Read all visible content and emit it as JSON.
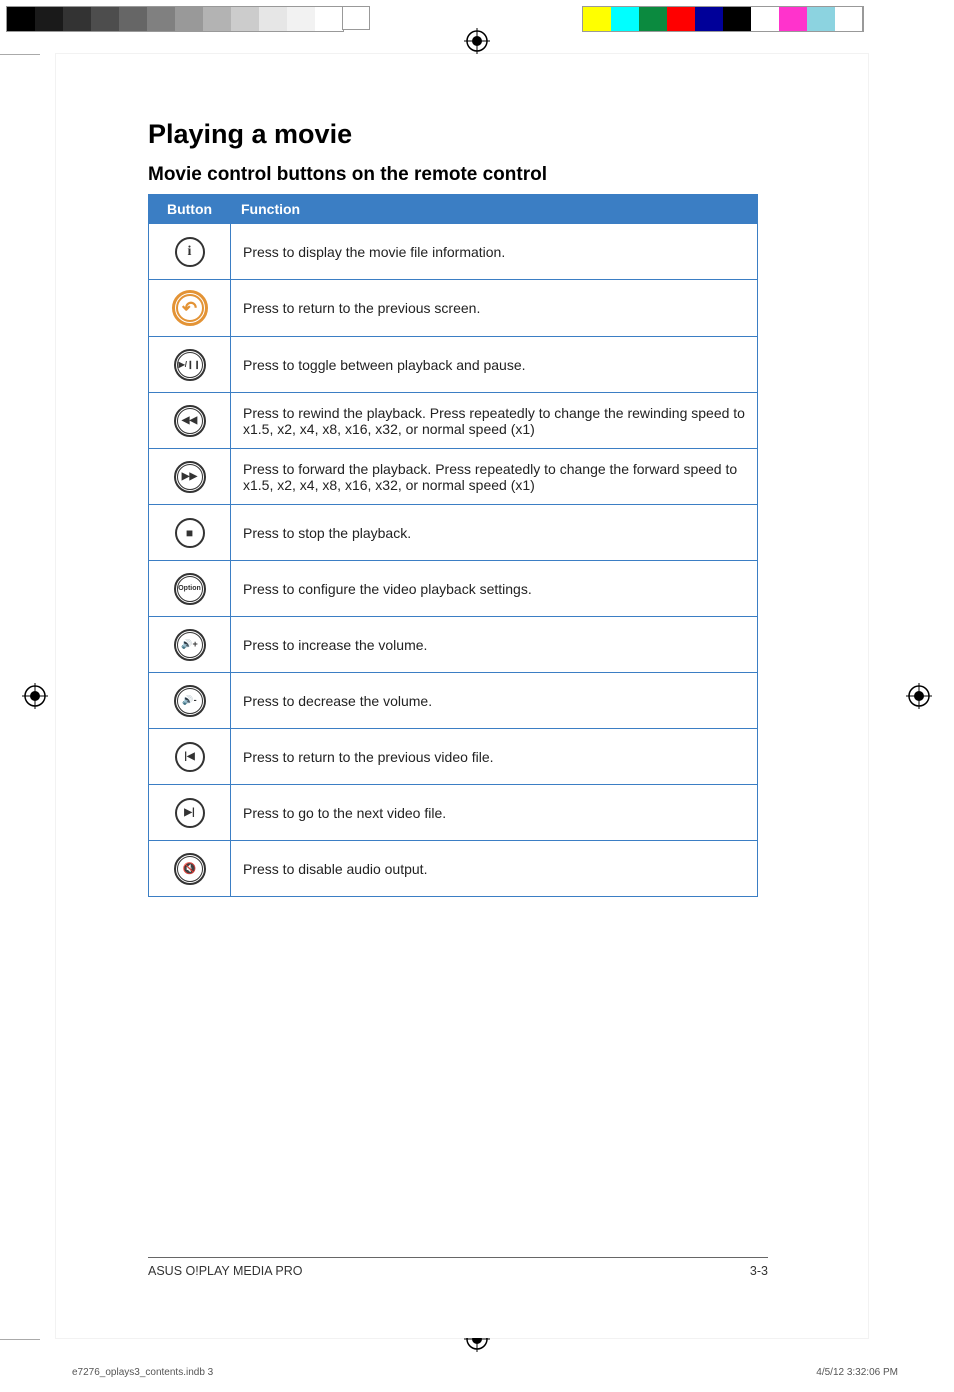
{
  "headings": {
    "h1": "Playing a movie",
    "h2": "Movie control buttons on the remote control"
  },
  "table": {
    "headers": {
      "button": "Button",
      "function": "Function"
    },
    "rows": [
      {
        "icon": "info",
        "glyph": "i",
        "desc": "Press to display the movie file information."
      },
      {
        "icon": "back",
        "glyph": "↶",
        "desc": "Press to return to the previous screen."
      },
      {
        "icon": "play-pause",
        "glyph": "▶/❙❙",
        "desc": "Press to toggle between playback and pause."
      },
      {
        "icon": "rewind",
        "glyph": "◀◀",
        "desc": "Press to rewind the playback. Press repeatedly to change the rewinding speed to x1.5, x2, x4, x8, x16, x32, or normal speed (x1)"
      },
      {
        "icon": "forward",
        "glyph": "▶▶",
        "desc": "Press to forward the playback. Press repeatedly to change the forward speed to x1.5, x2, x4, x8, x16, x32, or normal speed (x1)"
      },
      {
        "icon": "stop",
        "glyph": "■",
        "desc": "Press to stop the playback."
      },
      {
        "icon": "option",
        "glyph": "Option",
        "desc": "Press to configure the video playback settings."
      },
      {
        "icon": "vol-up",
        "glyph": "🔊+",
        "desc": "Press to increase the volume."
      },
      {
        "icon": "vol-down",
        "glyph": "🔊-",
        "desc": "Press to decrease the volume."
      },
      {
        "icon": "prev-track",
        "glyph": "|◀",
        "desc": "Press to return to the previous video file."
      },
      {
        "icon": "next-track",
        "glyph": "▶|",
        "desc": "Press to go to the next video file."
      },
      {
        "icon": "mute",
        "glyph": "🔇",
        "desc": "Press to disable audio output."
      }
    ]
  },
  "footer": {
    "product": "ASUS O!PLAY MEDIA PRO",
    "page": "3-3"
  },
  "slug": {
    "file": "e7276_oplays3_contents.indb   3",
    "datetime": "4/5/12   3:32:06 PM"
  }
}
